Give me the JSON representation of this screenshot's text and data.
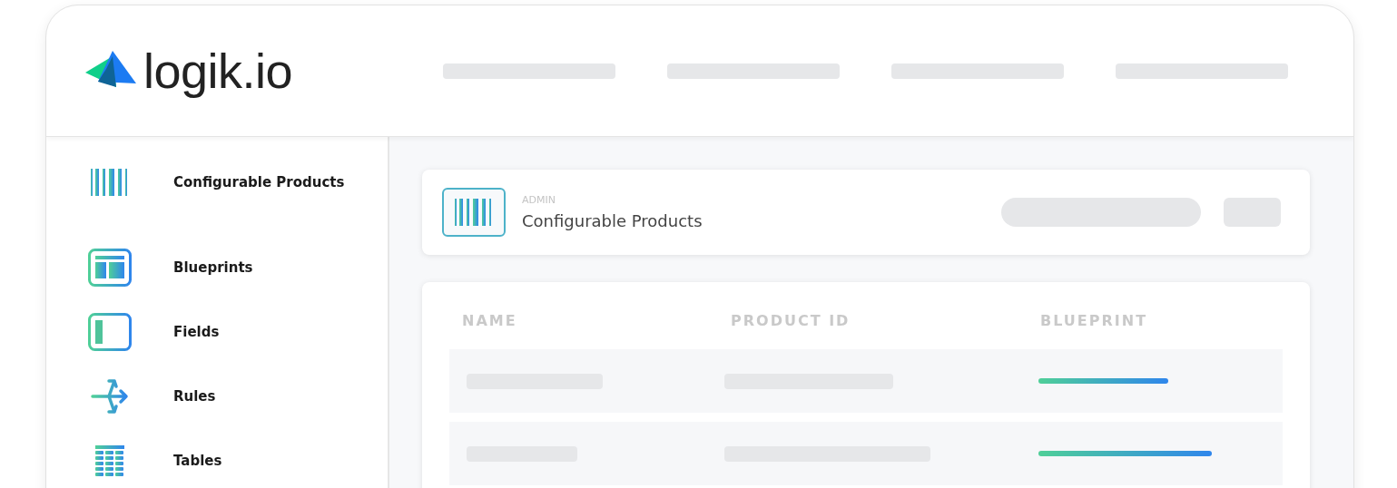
{
  "brand": {
    "name": "logik.io"
  },
  "sidebar": {
    "items": [
      {
        "kind": "products",
        "label": "Configurable Products"
      },
      {
        "kind": "blueprints",
        "label": "Blueprints"
      },
      {
        "kind": "fields",
        "label": "Fields"
      },
      {
        "kind": "rules",
        "label": "Rules"
      },
      {
        "kind": "tables",
        "label": "Tables"
      }
    ]
  },
  "page_header": {
    "eyebrow": "ADMIN",
    "title": "Configurable Products"
  },
  "table": {
    "columns": [
      "NAME",
      "PRODUCT ID",
      "BLUEPRINT"
    ]
  }
}
